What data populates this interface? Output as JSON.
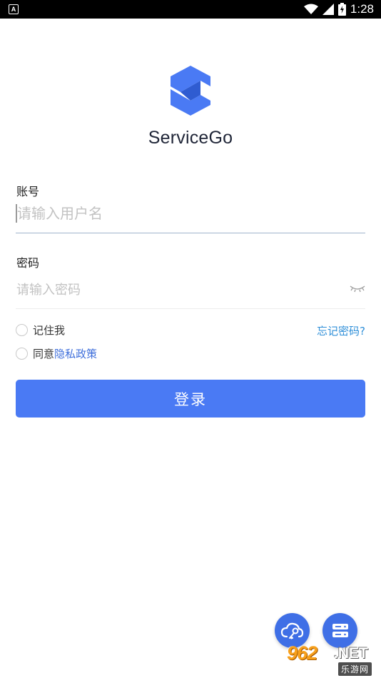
{
  "status_bar": {
    "notification_icon": "A",
    "time": "1:28",
    "icons": [
      "wifi-icon",
      "cell-signal-icon",
      "battery-icon"
    ]
  },
  "app": {
    "name": "ServiceGo",
    "logo_icon": "servicego-logo-icon",
    "brand_color": "#4a7af4"
  },
  "form": {
    "account_label": "账号",
    "account_placeholder": "请输入用户名",
    "account_value": "",
    "password_label": "密码",
    "password_placeholder": "请输入密码",
    "password_value": "",
    "password_toggle_icon": "eye-closed-icon",
    "remember_label": "记住我",
    "forgot_label": "忘记密码?",
    "agree_prefix": "同意",
    "privacy_link": "隐私政策",
    "login_button": "登录"
  },
  "fabs": [
    {
      "icon": "cloud-key-icon"
    },
    {
      "icon": "server-icon"
    }
  ],
  "watermark": {
    "number": "962",
    "suffix": ".NET",
    "subtitle": "乐游网"
  }
}
